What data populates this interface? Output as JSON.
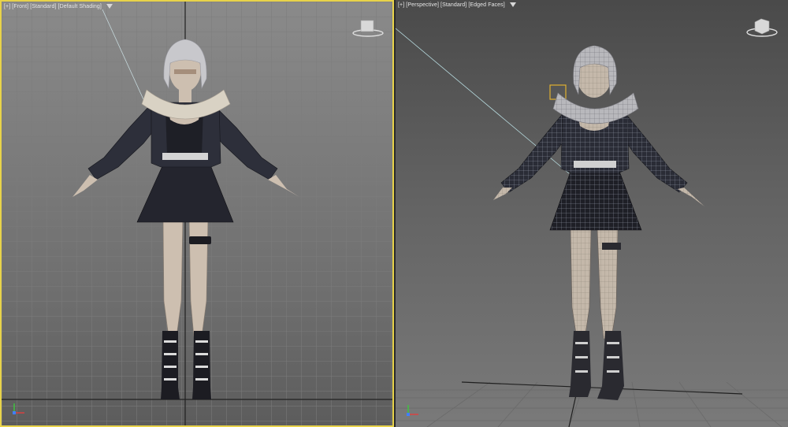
{
  "viewports": {
    "front": {
      "menu": "[+]",
      "view": "[Front]",
      "shading_mode": "[Standard]",
      "display": "[Default Shading]",
      "active": true,
      "accent": "#e8d34a"
    },
    "perspective": {
      "menu": "[+]",
      "view": "[Perspective]",
      "shading_mode": "[Standard]",
      "display": "[Edged Faces]",
      "active": false
    }
  },
  "icons": {
    "viewcube": "viewcube-icon",
    "filter": "filter-icon",
    "axis": "axis-tripod-icon"
  },
  "colors": {
    "grid_front": "#7c7c7c",
    "grid_persp": "#6a6a6a",
    "jacket": "#2d2f3a",
    "skirt": "#24252e",
    "skin": "#cdbfb0",
    "hair": "#c8c8cc",
    "boots": "#1c1c22"
  }
}
